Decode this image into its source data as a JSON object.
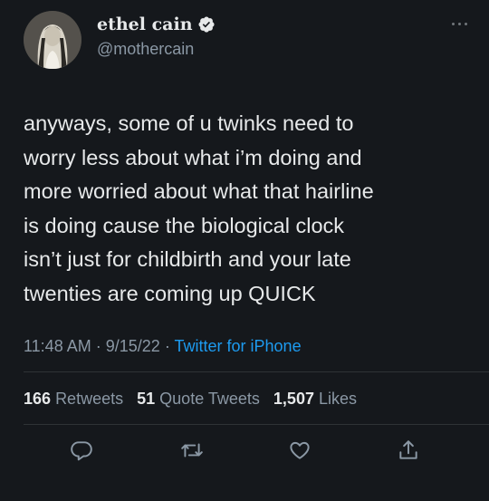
{
  "user": {
    "display_name": "ethel cain",
    "handle": "@mothercain",
    "verified": true
  },
  "tweet": {
    "lines": [
      "anyways, some of u twinks need to",
      "worry less about what i’m doing and",
      "more worried about what that hairline",
      "is doing cause the biological clock",
      "isn’t just for childbirth and your late",
      "twenties are coming up QUICK"
    ],
    "time": "11:48 AM",
    "sep": "·",
    "date": "9/15/22",
    "source": "Twitter for iPhone"
  },
  "stats": {
    "retweets_count": "166",
    "retweets_label": "Retweets",
    "quotes_count": "51",
    "quotes_label": "Quote Tweets",
    "likes_count": "1,507",
    "likes_label": "Likes"
  },
  "icons": {
    "more": "more-icon",
    "verified": "verified-badge-icon",
    "reply": "reply-icon",
    "retweet": "retweet-icon",
    "like": "like-icon",
    "share": "share-icon"
  },
  "colors": {
    "background": "#15181c",
    "text": "#e7e9ea",
    "secondary": "#8b98a5",
    "link": "#1d9bf0",
    "divider": "#2f3336"
  }
}
